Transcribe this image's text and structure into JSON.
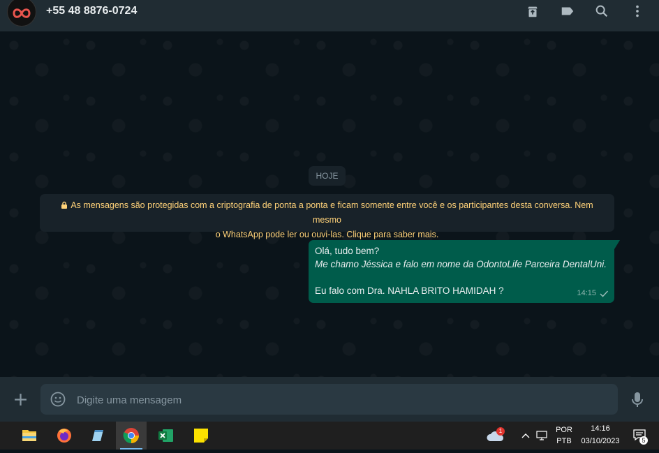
{
  "header": {
    "contact_name": "+55 48 8876-0724",
    "icons": [
      "archive-icon",
      "label-icon",
      "search-icon",
      "menu-icon"
    ]
  },
  "chat": {
    "day_label": "HOJE",
    "encryption_notice_line1": "As mensagens são protegidas com a criptografia de ponta a ponta e ficam somente entre você e os participantes desta conversa. Nem mesmo",
    "encryption_notice_line2": "o WhatsApp pode ler ou ouvi-las. Clique para saber mais.",
    "message": {
      "line1": "Olá, tudo bem?",
      "line2": "Me chamo Jéssica e falo em nome da OdontoLife Parceira DentalUni.",
      "line3": "Eu falo com Dra. NAHLA BRITO HAMIDAH ?",
      "time": "14:15",
      "status": "sent"
    }
  },
  "compose": {
    "placeholder": "Digite uma mensagem"
  },
  "taskbar": {
    "weather_badge": "1",
    "lang_top": "POR",
    "lang_bottom": "PTB",
    "time": "14:16",
    "date": "03/10/2023",
    "notif_count": "5"
  },
  "colors": {
    "header_bg": "#202c33",
    "chat_bg": "#0b141a",
    "outgoing_bubble": "#005c4b",
    "notice_text": "#ffd279"
  }
}
